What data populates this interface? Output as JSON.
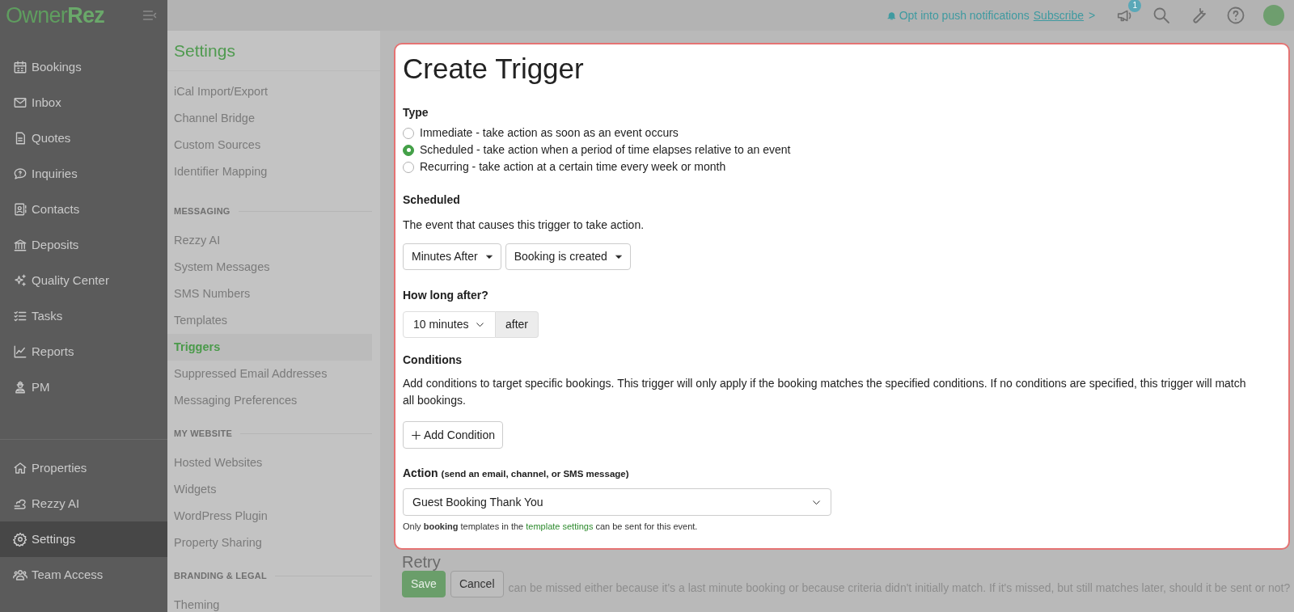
{
  "brand": {
    "light": "Owner",
    "bold": "Rez"
  },
  "topbar": {
    "notice": "Opt into push notifications",
    "link": "Subscribe",
    "link_arrow": ">",
    "badge": "1"
  },
  "sidebar": {
    "items": [
      {
        "label": "Bookings",
        "selected": false
      },
      {
        "label": "Inbox",
        "selected": false
      },
      {
        "label": "Quotes",
        "selected": false
      },
      {
        "label": "Inquiries",
        "selected": false
      },
      {
        "label": "Contacts",
        "selected": false
      },
      {
        "label": "Deposits",
        "selected": false
      },
      {
        "label": "Quality Center",
        "selected": false
      },
      {
        "label": "Tasks",
        "selected": false
      },
      {
        "label": "Reports",
        "selected": false
      },
      {
        "label": "PM",
        "selected": false
      }
    ],
    "bottom_items": [
      {
        "label": "Properties",
        "selected": false
      },
      {
        "label": "Rezzy AI",
        "selected": false
      },
      {
        "label": "Settings",
        "selected": true
      },
      {
        "label": "Team Access",
        "selected": false
      }
    ]
  },
  "settings_nav": {
    "title": "Settings",
    "sections": [
      {
        "items": [
          {
            "label": "iCal Import/Export",
            "selected": false
          },
          {
            "label": "Channel Bridge",
            "selected": false
          },
          {
            "label": "Custom Sources",
            "selected": false
          },
          {
            "label": "Identifier Mapping",
            "selected": false
          }
        ]
      },
      {
        "heading": "MESSAGING",
        "items": [
          {
            "label": "Rezzy AI",
            "selected": false
          },
          {
            "label": "System Messages",
            "selected": false
          },
          {
            "label": "SMS Numbers",
            "selected": false
          },
          {
            "label": "Templates",
            "selected": false
          },
          {
            "label": "Triggers",
            "selected": true
          },
          {
            "label": "Suppressed Email Addresses",
            "selected": false
          },
          {
            "label": "Messaging Preferences",
            "selected": false
          }
        ]
      },
      {
        "heading": "MY WEBSITE",
        "items": [
          {
            "label": "Hosted Websites",
            "selected": false
          },
          {
            "label": "Widgets",
            "selected": false
          },
          {
            "label": "WordPress Plugin",
            "selected": false
          },
          {
            "label": "Property Sharing",
            "selected": false
          }
        ]
      },
      {
        "heading": "BRANDING & LEGAL",
        "items": [
          {
            "label": "Theming",
            "selected": false
          }
        ]
      }
    ]
  },
  "form": {
    "title": "Create Trigger",
    "type": {
      "label": "Type",
      "options": [
        {
          "label": "Immediate - take action as soon as an event occurs",
          "selected": false
        },
        {
          "label": "Scheduled - take action when a period of time elapses relative to an event",
          "selected": true
        },
        {
          "label": "Recurring - take action at a certain time every week or month",
          "selected": false
        }
      ]
    },
    "scheduled": {
      "label": "Scheduled",
      "description": "The event that causes this trigger to take action.",
      "dropdowns": [
        "Minutes After",
        "Booking is created"
      ]
    },
    "how_long": {
      "label": "How long after?",
      "value": "10 minutes",
      "addon": "after"
    },
    "conditions": {
      "label": "Conditions",
      "description": "Add conditions to target specific bookings. This trigger will only apply if the booking matches the specified conditions. If no conditions are specified, this trigger will match all bookings.",
      "button": "Add Condition"
    },
    "action": {
      "label": "Action",
      "hint": "(send an email, channel, or SMS message)",
      "value": "Guest Booking Thank You",
      "note_before": "Only **booking** templates in the",
      "note_link": "template settings",
      "note_after": "can be sent for this event."
    }
  },
  "retry": {
    "title": "Retry",
    "text": "can be missed either because it's a last minute booking or because criteria didn't initially match. If it's missed, but still matches later, should it be sent or not?"
  },
  "buttons": [
    {
      "label": "Save",
      "kind": "primary"
    },
    {
      "label": "Cancel",
      "kind": "secondary"
    }
  ]
}
